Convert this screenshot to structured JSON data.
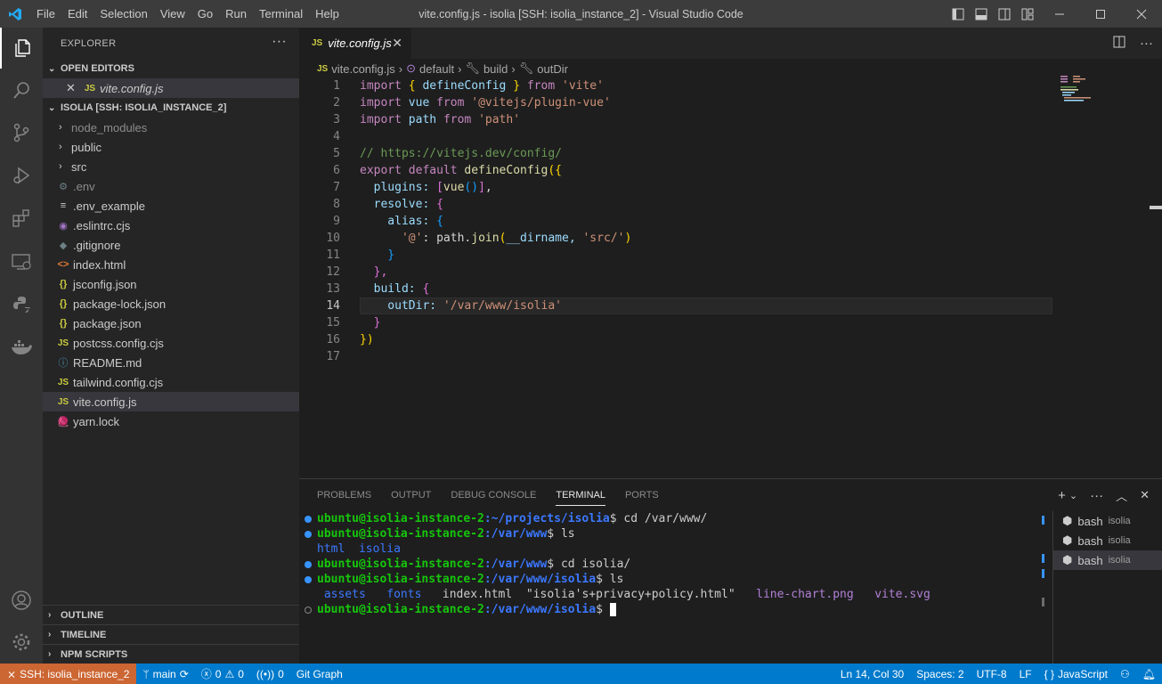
{
  "window": {
    "title": "vite.config.js - isolia [SSH: isolia_instance_2] - Visual Studio Code",
    "menu": [
      "File",
      "Edit",
      "Selection",
      "View",
      "Go",
      "Run",
      "Terminal",
      "Help"
    ]
  },
  "explorer": {
    "header": "EXPLORER",
    "open_editors_label": "OPEN EDITORS",
    "open_editor_file": "vite.config.js",
    "workspace_label": "ISOLIA [SSH: ISOLIA_INSTANCE_2]",
    "items": [
      {
        "label": "node_modules",
        "kind": "folder",
        "icon": "chevron-right"
      },
      {
        "label": "public",
        "kind": "folder",
        "icon": "chevron-right"
      },
      {
        "label": "src",
        "kind": "folder",
        "icon": "chevron-right"
      },
      {
        "label": ".env",
        "kind": "file",
        "icon": "gear-icon"
      },
      {
        "label": ".env_example",
        "kind": "file",
        "icon": "lines-icon"
      },
      {
        "label": ".eslintrc.cjs",
        "kind": "file",
        "icon": "eslint-icon"
      },
      {
        "label": ".gitignore",
        "kind": "file",
        "icon": "git-icon"
      },
      {
        "label": "index.html",
        "kind": "file",
        "icon": "html-icon"
      },
      {
        "label": "jsconfig.json",
        "kind": "file",
        "icon": "json-icon"
      },
      {
        "label": "package-lock.json",
        "kind": "file",
        "icon": "json-icon"
      },
      {
        "label": "package.json",
        "kind": "file",
        "icon": "json-icon"
      },
      {
        "label": "postcss.config.cjs",
        "kind": "file",
        "icon": "js-icon"
      },
      {
        "label": "README.md",
        "kind": "file",
        "icon": "info-icon"
      },
      {
        "label": "tailwind.config.cjs",
        "kind": "file",
        "icon": "js-icon"
      },
      {
        "label": "vite.config.js",
        "kind": "file",
        "icon": "js-icon"
      },
      {
        "label": "yarn.lock",
        "kind": "file",
        "icon": "yarn-icon"
      }
    ],
    "outline_label": "OUTLINE",
    "timeline_label": "TIMELINE",
    "npm_scripts_label": "NPM SCRIPTS"
  },
  "editor": {
    "tab_label": "vite.config.js",
    "tab_badge": "JS",
    "breadcrumb": [
      "vite.config.js",
      "default",
      "build",
      "outDir"
    ],
    "line_numbers": [
      "1",
      "2",
      "3",
      "4",
      "5",
      "6",
      "7",
      "8",
      "9",
      "10",
      "11",
      "12",
      "13",
      "14",
      "15",
      "16",
      "17"
    ],
    "current_line": 14,
    "lines": {
      "l1_kw": "import",
      "l1_b": " { ",
      "l1_v": "defineConfig",
      "l1_b2": " } ",
      "l1_from": "from",
      "l1_s": " 'vite'",
      "l2_kw": "import",
      "l2_v": " vue ",
      "l2_from": "from",
      "l2_s": " '@vitejs/plugin-vue'",
      "l3_kw": "import",
      "l3_v": " path ",
      "l3_from": "from",
      "l3_s": " 'path'",
      "l5_c": "// https://vitejs.dev/config/",
      "l6_kw": "export default",
      "l6_f": " defineConfig",
      "l6_b": "({",
      "l7": "  plugins: ",
      "l7_b": "[",
      "l7_f": "vue",
      "l7_p": "()",
      "l7_b2": "]",
      "l7_e": ",",
      "l8": "  resolve: ",
      "l8_b": "{",
      "l9": "    alias: ",
      "l9_b": "{",
      "l10_s": "      '@'",
      "l10_p": ": path.",
      "l10_f": "join",
      "l10_b": "(",
      "l10_v": "__dirname, ",
      "l10_s2": "'src/'",
      "l10_b2": ")",
      "l11": "    }",
      "l12": "  },",
      "l13": "  build: ",
      "l13_b": "{",
      "l14": "    outDir: ",
      "l14_s": "'/var/www/isolia'",
      "l15": "  }",
      "l16": "})"
    }
  },
  "panel": {
    "tabs": [
      "PROBLEMS",
      "OUTPUT",
      "DEBUG CONSOLE",
      "TERMINAL",
      "PORTS"
    ],
    "active_tab": "TERMINAL",
    "terminal": {
      "user_host": "ubuntu@isolia-instance-2",
      "l1_path": ":~/projects/isolia",
      "l1_cmd": "$ cd /var/www/",
      "l2_path": ":/var/www",
      "l2_cmd": "$ ls",
      "l3_a": "html",
      "l3_b": "isolia",
      "l4_path": ":/var/www",
      "l4_cmd": "$ cd isolia/",
      "l5_path": ":/var/www/isolia",
      "l5_cmd": "$ ls",
      "l6_a": "assets",
      "l6_b": "fonts",
      "l6_c": "index.html",
      "l6_d": "\"isolia's+privacy+policy.html\"",
      "l6_e": "line-chart.png",
      "l6_f": "vite.svg",
      "l7_path": ":/var/www/isolia",
      "l7_cmd": "$ "
    },
    "sessions": [
      {
        "label": "bash",
        "sub": "isolia"
      },
      {
        "label": "bash",
        "sub": "isolia"
      },
      {
        "label": "bash",
        "sub": "isolia"
      }
    ]
  },
  "status": {
    "remote": "SSH: isolia_instance_2",
    "branch": "main",
    "errors": "0",
    "warnings": "0",
    "ports": "0",
    "git_graph": "Git Graph",
    "cursor": "Ln 14, Col 30",
    "spaces": "Spaces: 2",
    "encoding": "UTF-8",
    "eol": "LF",
    "language": "JavaScript"
  },
  "colors": {
    "accent": "#007acc",
    "remote": "#cc6633",
    "terminal_user": "#16c60c",
    "terminal_path": "#3b78ff"
  }
}
